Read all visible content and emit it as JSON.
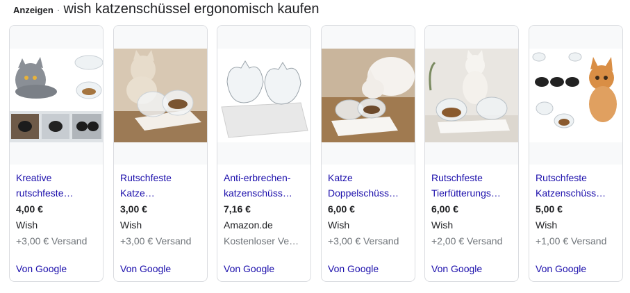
{
  "header": {
    "ads_label": "Anzeigen",
    "separator": "·",
    "query": "wish katzenschüssel ergonomisch kaufen"
  },
  "cards": [
    {
      "title": "Kreative rutschfeste…",
      "price": "4,00 €",
      "merchant": "Wish",
      "shipping": "+3,00 € Versand",
      "source": "Von Google"
    },
    {
      "title": "Rutschfeste Katze…",
      "price": "3,00 €",
      "merchant": "Wish",
      "shipping": "+3,00 € Versand",
      "source": "Von Google"
    },
    {
      "title": "Anti-erbrechen-katzenschüss…",
      "price": "7,16 €",
      "merchant": "Amazon.de",
      "shipping": "Kostenloser Ve…",
      "source": "Von Google"
    },
    {
      "title": "Katze Doppelschüss…",
      "price": "6,00 €",
      "merchant": "Wish",
      "shipping": "+3,00 € Versand",
      "source": "Von Google"
    },
    {
      "title": "Rutschfeste Tierfütterungs…",
      "price": "6,00 €",
      "merchant": "Wish",
      "shipping": "+2,00 € Versand",
      "source": "Von Google"
    },
    {
      "title": "Rutschfeste Katzenschüss…",
      "price": "5,00 €",
      "merchant": "Wish",
      "shipping": "+1,00 € Versand",
      "source": "Von Google"
    }
  ],
  "colors": {
    "link": "#1a0dab",
    "secondary_text": "#70757a",
    "border": "#dadce0"
  },
  "icons": [
    "product-image-cat-bowl"
  ]
}
